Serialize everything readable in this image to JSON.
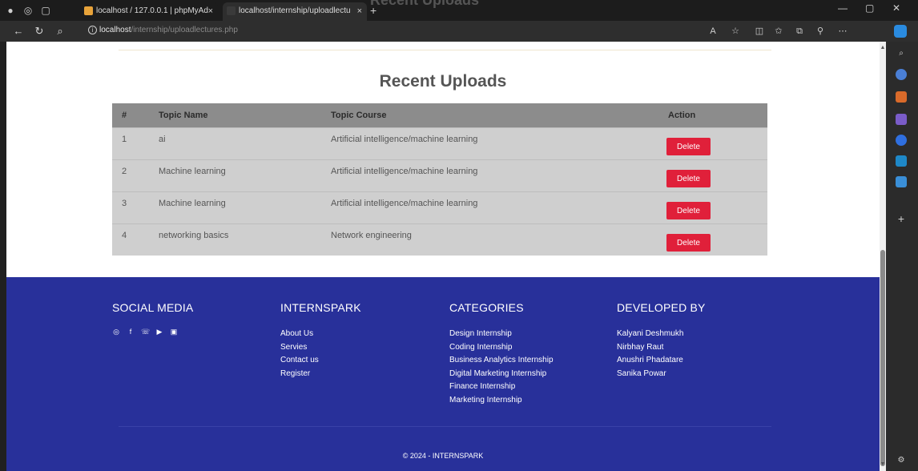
{
  "browser": {
    "tabs": [
      {
        "title": "localhost / 127.0.0.1 | phpMyAd",
        "favicon_color": "#e8a33a"
      },
      {
        "title": "localhost/internship/uploadlectu",
        "favicon_color": "#2e2e2e"
      }
    ],
    "tab_close": "×",
    "new_tab": "+",
    "url_host": "localhost",
    "url_path": "/internship/uploadlectures.php",
    "behind_title": "Recent Uploads"
  },
  "page": {
    "title": "Recent Uploads",
    "table": {
      "headers": [
        "#",
        "Topic Name",
        "Topic Course",
        "Action"
      ],
      "rows": [
        {
          "num": "1",
          "name": "ai",
          "course": "Artificial intelligence/machine learning",
          "action": "Delete"
        },
        {
          "num": "2",
          "name": "Machine learning",
          "course": "Artificial intelligence/machine learning",
          "action": "Delete"
        },
        {
          "num": "3",
          "name": "Machine learning",
          "course": "Artificial intelligence/machine learning",
          "action": "Delete"
        },
        {
          "num": "4",
          "name": "networking basics",
          "course": "Network engineering",
          "action": "Delete"
        }
      ]
    }
  },
  "footer": {
    "social": {
      "heading": "SOCIAL MEDIA",
      "icons": [
        "instagram-icon",
        "facebook-icon",
        "whatsapp-icon",
        "youtube-icon",
        "linkedin-icon"
      ]
    },
    "internspark": {
      "heading": "INTERNSPARK",
      "links": [
        "About Us",
        "Servies",
        "Contact us",
        "Register"
      ]
    },
    "categories": {
      "heading": "CATEGORIES",
      "links": [
        "Design Internship",
        "Coding Internship",
        "Business Analytics Internship",
        "Digital Marketing Internship",
        "Finance Internship",
        "Marketing Internship"
      ]
    },
    "developed": {
      "heading": "DEVELOPED BY",
      "names": [
        "Kalyani Deshmukh",
        "Nirbhay Raut",
        "Anushri Phadatare",
        "Sanika Powar"
      ]
    },
    "copyright": "© 2024 - INTERNSPARK"
  },
  "colors": {
    "footer_bg": "#28309a",
    "delete_btn": "#e0203a",
    "table_header": "#8c8c8c",
    "table_body": "#cfcfcf"
  }
}
